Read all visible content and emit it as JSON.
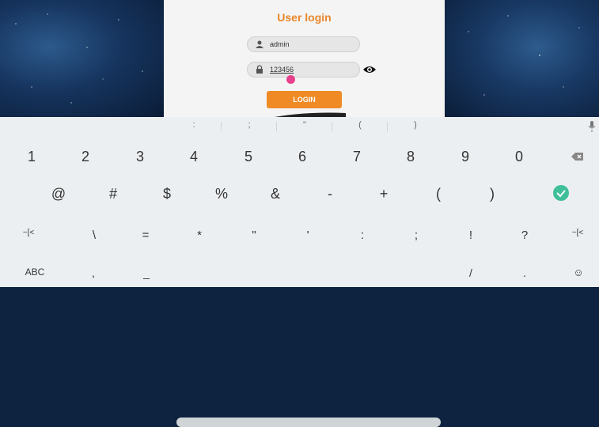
{
  "login": {
    "title": "User login",
    "username": "admin",
    "password": "123456",
    "button": "LOGIN"
  },
  "keyboard": {
    "suggestions": [
      ":",
      ";",
      "\"",
      "(",
      ")"
    ],
    "row1": [
      "1",
      "2",
      "3",
      "4",
      "5",
      "6",
      "7",
      "8",
      "9",
      "0"
    ],
    "row2": [
      "@",
      "#",
      "$",
      "%",
      "&",
      "-",
      "+",
      "(",
      ")"
    ],
    "row3": [
      "~[<",
      "\\",
      "=",
      "*",
      "\"",
      "'",
      ":",
      ";",
      "!",
      "?",
      "~[<"
    ],
    "row4": {
      "abc": "ABC",
      "comma": ",",
      "underscore": "_",
      "slash": "/",
      "dot": ".",
      "emoji": "☺"
    }
  },
  "colors": {
    "accent": "#e8862a",
    "button": "#ef8a25",
    "check": "#3fbf9a",
    "cursor": "#e8408c"
  }
}
